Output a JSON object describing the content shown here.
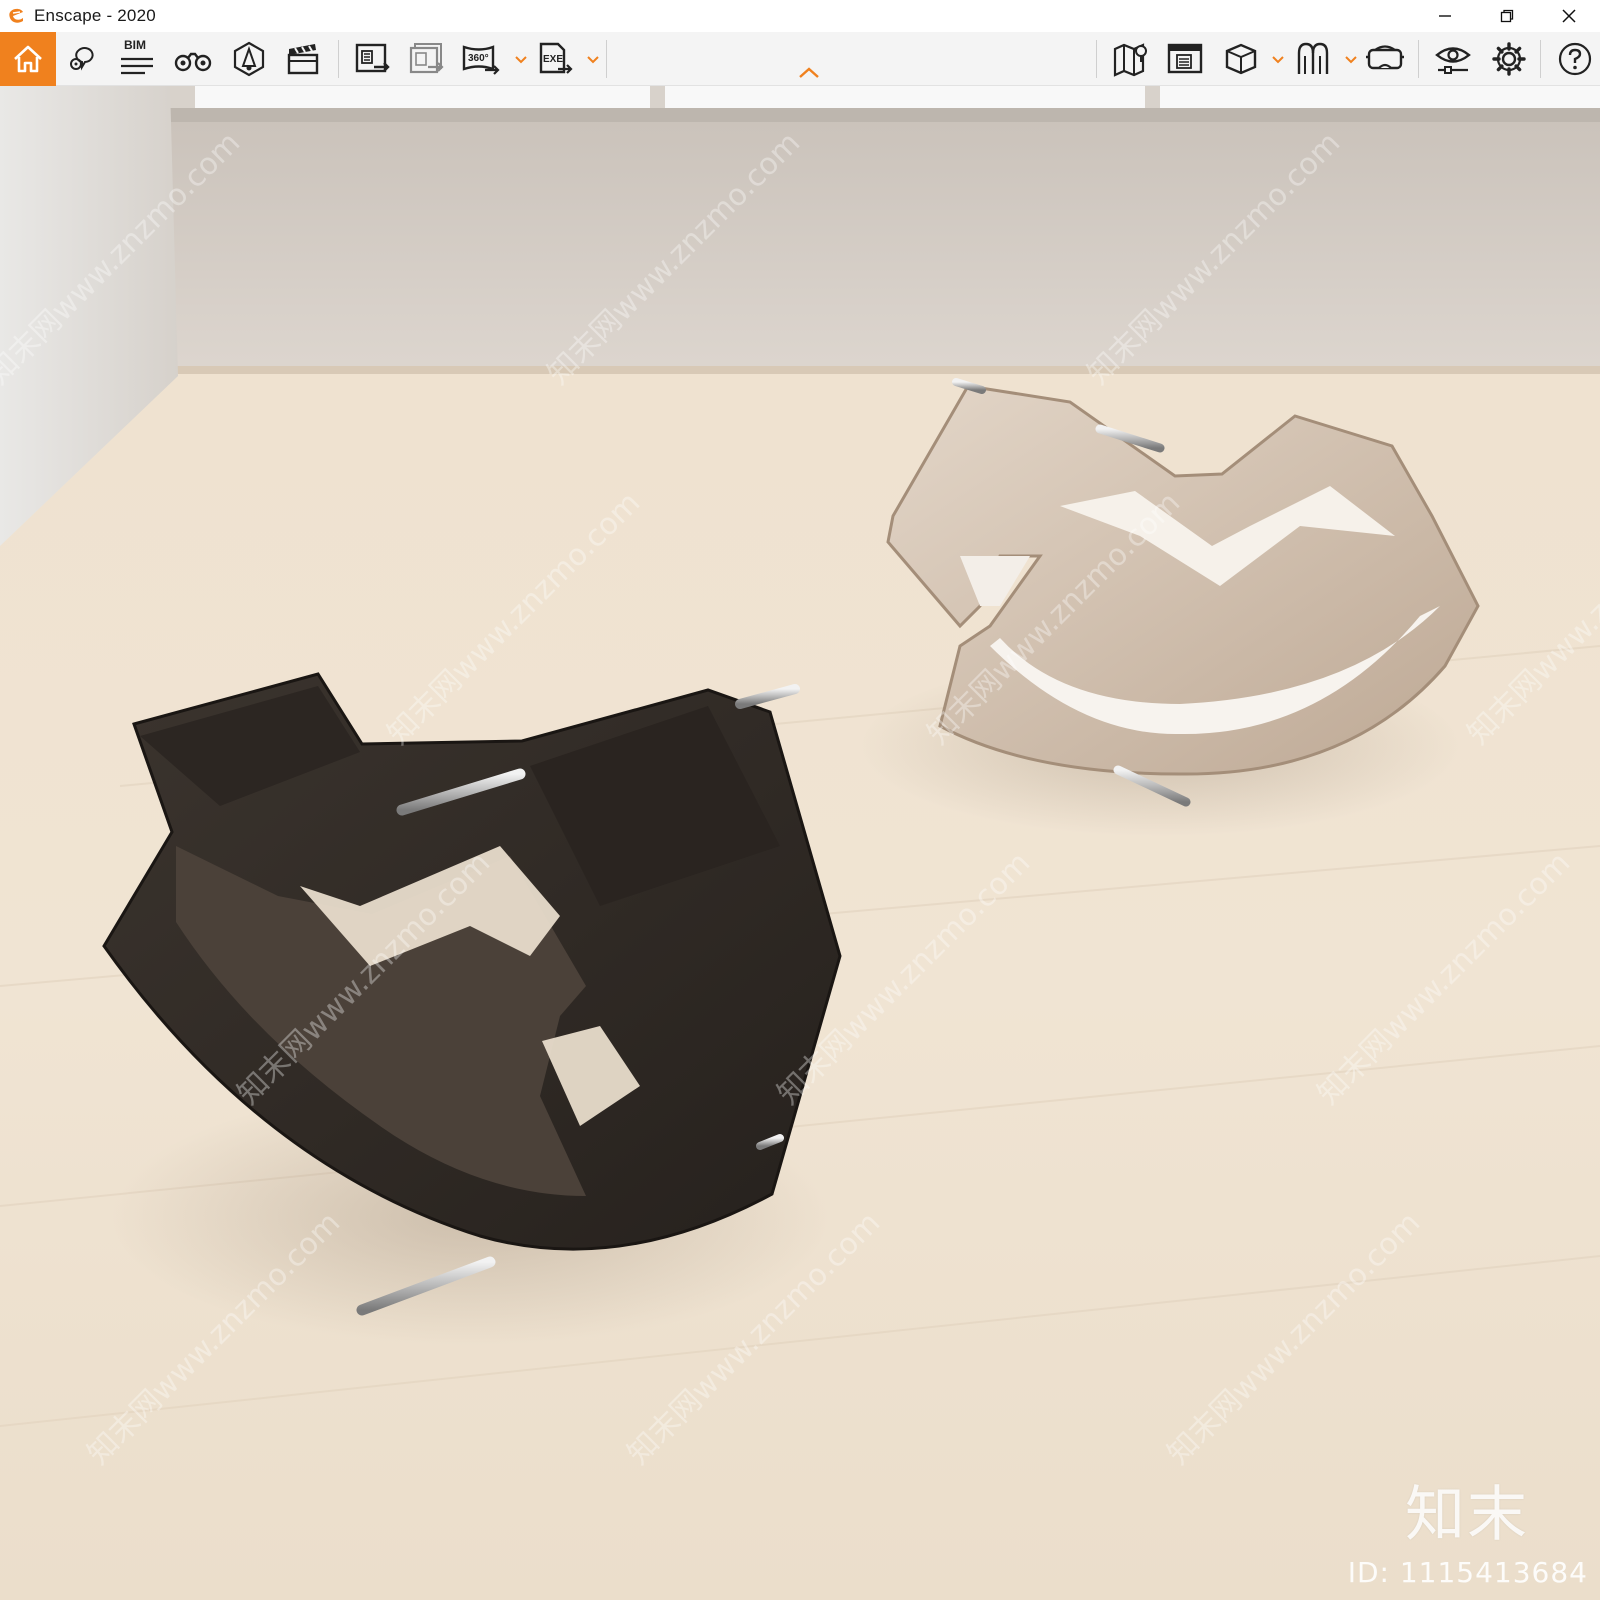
{
  "window": {
    "title": "Enscape - 2020",
    "accent_color": "#f0811e"
  },
  "toolbar": {
    "left_tools": [
      {
        "name": "home",
        "icon": "home-icon"
      },
      {
        "name": "views",
        "icon": "location-views-icon"
      },
      {
        "name": "bim",
        "icon": "bim-icon",
        "label": "BIM"
      },
      {
        "name": "walk",
        "icon": "binoculars-icon"
      },
      {
        "name": "assets",
        "icon": "asset-library-icon"
      },
      {
        "name": "video",
        "icon": "clapperboard-icon"
      },
      {
        "name": "render",
        "icon": "render-image-icon"
      },
      {
        "name": "batch",
        "icon": "batch-render-icon"
      },
      {
        "name": "panorama",
        "icon": "panorama-360-icon",
        "label": "360°"
      },
      {
        "name": "exe",
        "icon": "export-exe-icon",
        "label": "EXE"
      }
    ],
    "right_tools": [
      {
        "name": "map",
        "icon": "map-icon"
      },
      {
        "name": "objects",
        "icon": "render-window-icon"
      },
      {
        "name": "cube",
        "icon": "cube-icon"
      },
      {
        "name": "horse",
        "icon": "archway-icon"
      },
      {
        "name": "vr",
        "icon": "vr-headset-icon"
      },
      {
        "name": "visual",
        "icon": "eye-settings-icon"
      },
      {
        "name": "settings",
        "icon": "gear-icon"
      },
      {
        "name": "help",
        "icon": "help-icon"
      }
    ]
  },
  "watermark": {
    "logo": "知末",
    "id_text": "ID: 1115413684",
    "diagonal_text": "知末网www.znzmo.com"
  }
}
